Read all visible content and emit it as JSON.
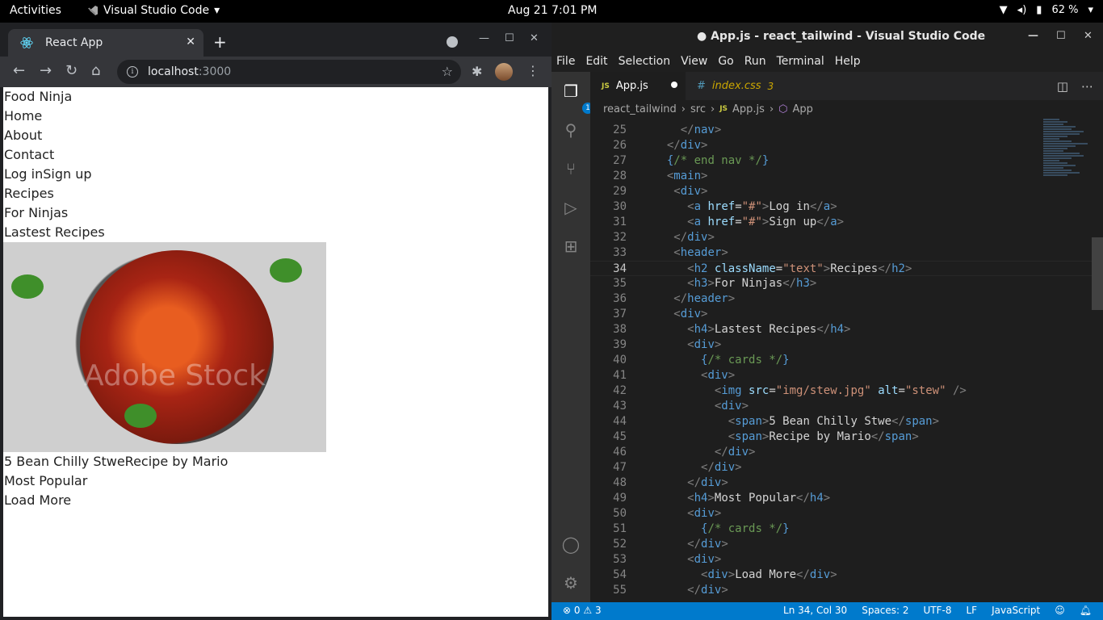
{
  "topbar": {
    "activities": "Activities",
    "app_name": "Visual Studio Code",
    "clock": "Aug 21  7:01 PM",
    "battery": "62 %"
  },
  "browser": {
    "tab_title": "React App",
    "url_host": "localhost",
    "url_port": ":3000",
    "page_lines_top": [
      "Food Ninja",
      "Home",
      "About",
      "Contact",
      "Log inSign up",
      "Recipes",
      "For Ninjas",
      "Lastest Recipes"
    ],
    "image_alt": "stew",
    "image_watermark": "Adobe Stock",
    "page_lines_bottom": [
      "5 Bean Chilly StweRecipe by Mario",
      "Most Popular",
      "Load More"
    ]
  },
  "vscode": {
    "window_title": "● App.js - react_tailwind - Visual Studio Code",
    "menu": [
      "File",
      "Edit",
      "Selection",
      "View",
      "Go",
      "Run",
      "Terminal",
      "Help"
    ],
    "explorer_badge": "1",
    "tabs": [
      {
        "label": "App.js",
        "lang": "JS"
      },
      {
        "label": "index.css",
        "lang": "#",
        "problems": "3"
      }
    ],
    "breadcrumb": [
      "react_tailwind",
      "src",
      "App.js",
      "App"
    ],
    "breadcrumb_lang": "JS",
    "current_line": 34,
    "code_lines": [
      {
        "n": 25,
        "html": "    <span class=\"p\">&lt;/</span><span class=\"tag\">nav</span><span class=\"p\">&gt;</span>"
      },
      {
        "n": 26,
        "html": "  <span class=\"p\">&lt;/</span><span class=\"tag\">div</span><span class=\"p\">&gt;</span>"
      },
      {
        "n": 27,
        "html": "  <span class=\"brc\">{</span><span class=\"cmt\">/* end nav */</span><span class=\"brc\">}</span>"
      },
      {
        "n": 28,
        "html": "  <span class=\"p\">&lt;</span><span class=\"tag\">main</span><span class=\"p\">&gt;</span>"
      },
      {
        "n": 29,
        "html": "   <span class=\"p\">&lt;</span><span class=\"tag\">div</span><span class=\"p\">&gt;</span>"
      },
      {
        "n": 30,
        "html": "     <span class=\"p\">&lt;</span><span class=\"tag\">a</span> <span class=\"attr\">href</span>=<span class=\"str\">\"#\"</span><span class=\"p\">&gt;</span>Log in<span class=\"p\">&lt;/</span><span class=\"tag\">a</span><span class=\"p\">&gt;</span>"
      },
      {
        "n": 31,
        "html": "     <span class=\"p\">&lt;</span><span class=\"tag\">a</span> <span class=\"attr\">href</span>=<span class=\"str\">\"#\"</span><span class=\"p\">&gt;</span>Sign up<span class=\"p\">&lt;/</span><span class=\"tag\">a</span><span class=\"p\">&gt;</span>"
      },
      {
        "n": 32,
        "html": "   <span class=\"p\">&lt;/</span><span class=\"tag\">div</span><span class=\"p\">&gt;</span>"
      },
      {
        "n": 33,
        "html": "   <span class=\"p\">&lt;</span><span class=\"tag\">header</span><span class=\"p\">&gt;</span>"
      },
      {
        "n": 34,
        "html": "     <span class=\"p\">&lt;</span><span class=\"tag\">h2</span> <span class=\"attr\">className</span>=<span class=\"str\">\"text\"</span><span class=\"p\">&gt;</span>Recipes<span class=\"p\">&lt;/</span><span class=\"tag\">h2</span><span class=\"p\">&gt;</span>"
      },
      {
        "n": 35,
        "html": "     <span class=\"p\">&lt;</span><span class=\"tag\">h3</span><span class=\"p\">&gt;</span>For Ninjas<span class=\"p\">&lt;/</span><span class=\"tag\">h3</span><span class=\"p\">&gt;</span>"
      },
      {
        "n": 36,
        "html": "   <span class=\"p\">&lt;/</span><span class=\"tag\">header</span><span class=\"p\">&gt;</span>"
      },
      {
        "n": 37,
        "html": "   <span class=\"p\">&lt;</span><span class=\"tag\">div</span><span class=\"p\">&gt;</span>"
      },
      {
        "n": 38,
        "html": "     <span class=\"p\">&lt;</span><span class=\"tag\">h4</span><span class=\"p\">&gt;</span>Lastest Recipes<span class=\"p\">&lt;/</span><span class=\"tag\">h4</span><span class=\"p\">&gt;</span>"
      },
      {
        "n": 39,
        "html": "     <span class=\"p\">&lt;</span><span class=\"tag\">div</span><span class=\"p\">&gt;</span>"
      },
      {
        "n": 40,
        "html": "       <span class=\"brc\">{</span><span class=\"cmt\">/* cards */</span><span class=\"brc\">}</span>"
      },
      {
        "n": 41,
        "html": "       <span class=\"p\">&lt;</span><span class=\"tag\">div</span><span class=\"p\">&gt;</span>"
      },
      {
        "n": 42,
        "html": "         <span class=\"p\">&lt;</span><span class=\"tag\">img</span> <span class=\"attr\">src</span>=<span class=\"str\">\"img/stew.jpg\"</span> <span class=\"attr\">alt</span>=<span class=\"str\">\"stew\"</span> <span class=\"p\">/&gt;</span>"
      },
      {
        "n": 43,
        "html": "         <span class=\"p\">&lt;</span><span class=\"tag\">div</span><span class=\"p\">&gt;</span>"
      },
      {
        "n": 44,
        "html": "           <span class=\"p\">&lt;</span><span class=\"tag\">span</span><span class=\"p\">&gt;</span>5 Bean Chilly Stwe<span class=\"p\">&lt;/</span><span class=\"tag\">span</span><span class=\"p\">&gt;</span>"
      },
      {
        "n": 45,
        "html": "           <span class=\"p\">&lt;</span><span class=\"tag\">span</span><span class=\"p\">&gt;</span>Recipe by Mario<span class=\"p\">&lt;/</span><span class=\"tag\">span</span><span class=\"p\">&gt;</span>"
      },
      {
        "n": 46,
        "html": "         <span class=\"p\">&lt;/</span><span class=\"tag\">div</span><span class=\"p\">&gt;</span>"
      },
      {
        "n": 47,
        "html": "       <span class=\"p\">&lt;/</span><span class=\"tag\">div</span><span class=\"p\">&gt;</span>"
      },
      {
        "n": 48,
        "html": "     <span class=\"p\">&lt;/</span><span class=\"tag\">div</span><span class=\"p\">&gt;</span>"
      },
      {
        "n": 49,
        "html": "     <span class=\"p\">&lt;</span><span class=\"tag\">h4</span><span class=\"p\">&gt;</span>Most Popular<span class=\"p\">&lt;/</span><span class=\"tag\">h4</span><span class=\"p\">&gt;</span>"
      },
      {
        "n": 50,
        "html": "     <span class=\"p\">&lt;</span><span class=\"tag\">div</span><span class=\"p\">&gt;</span>"
      },
      {
        "n": 51,
        "html": "       <span class=\"brc\">{</span><span class=\"cmt\">/* cards */</span><span class=\"brc\">}</span>"
      },
      {
        "n": 52,
        "html": "     <span class=\"p\">&lt;/</span><span class=\"tag\">div</span><span class=\"p\">&gt;</span>"
      },
      {
        "n": 53,
        "html": "     <span class=\"p\">&lt;</span><span class=\"tag\">div</span><span class=\"p\">&gt;</span>"
      },
      {
        "n": 54,
        "html": "       <span class=\"p\">&lt;</span><span class=\"tag\">div</span><span class=\"p\">&gt;</span>Load More<span class=\"p\">&lt;/</span><span class=\"tag\">div</span><span class=\"p\">&gt;</span>"
      },
      {
        "n": 55,
        "html": "     <span class=\"p\">&lt;/</span><span class=\"tag\">div</span><span class=\"p\">&gt;</span>"
      }
    ],
    "status": {
      "errors": "0",
      "warnings": "3",
      "position": "Ln 34, Col 30",
      "spaces": "Spaces: 2",
      "encoding": "UTF-8",
      "eol": "LF",
      "language": "JavaScript"
    },
    "colors": {
      "accent": "#007acc",
      "tag": "#569cd6",
      "attr": "#9cdcfe",
      "string": "#ce9178",
      "comment": "#6a9955"
    }
  }
}
